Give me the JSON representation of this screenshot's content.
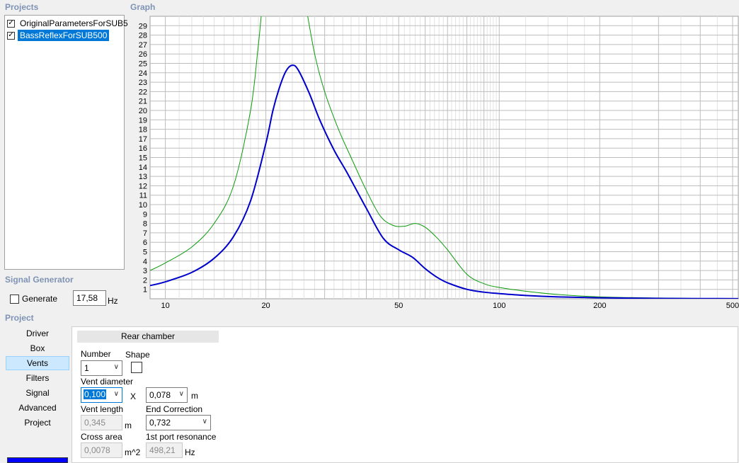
{
  "sections": {
    "projects": "Projects",
    "graph": "Graph",
    "signal_generator": "Signal Generator",
    "project": "Project"
  },
  "projects": [
    {
      "label": "OriginalParametersForSUB5",
      "checked": true,
      "selected": false
    },
    {
      "label": "BassReflexForSUB500",
      "checked": true,
      "selected": true
    }
  ],
  "signal": {
    "generate_label": "Generate",
    "frequency": "17,58",
    "unit": "Hz"
  },
  "nav": [
    "Driver",
    "Box",
    "Vents",
    "Filters",
    "Signal",
    "Advanced",
    "Project"
  ],
  "nav_active": 2,
  "rear": {
    "header": "Rear chamber",
    "number_label": "Number",
    "number_value": "1",
    "shape_label": "Shape",
    "vent_diameter_label": "Vent diameter",
    "vent_diameter_value": "0,100",
    "x_label": "X",
    "vent_diameter2_value": "0,078",
    "m_unit": "m",
    "vent_length_label": "Vent length",
    "vent_length_value": "0,345",
    "end_correction_label": "End Correction",
    "end_correction_value": "0,732",
    "cross_area_label": "Cross area",
    "cross_area_value": "0,0078",
    "cross_area_unit": "m^2",
    "port_resonance_label": "1st port resonance",
    "port_resonance_value": "498,21",
    "hz_unit": "Hz"
  },
  "chart_data": {
    "type": "line",
    "x_scale": "log",
    "xlim": [
      9,
      520
    ],
    "ylim": [
      0,
      30
    ],
    "x_ticks": [
      10,
      20,
      50,
      100,
      200,
      500
    ],
    "y_ticks": [
      1,
      2,
      3,
      4,
      5,
      6,
      7,
      8,
      9,
      10,
      11,
      12,
      13,
      14,
      15,
      16,
      17,
      18,
      19,
      20,
      21,
      22,
      23,
      24,
      25,
      26,
      27,
      28,
      29
    ],
    "grid": true,
    "series": [
      {
        "color": "#0b9b0b",
        "x": [
          9,
          10,
          12,
          14,
          16,
          18,
          19,
          20,
          22,
          24,
          26,
          28,
          30,
          33,
          36,
          40,
          44,
          48,
          52,
          56,
          60,
          65,
          70,
          80,
          90,
          100,
          120,
          150,
          200,
          300,
          400,
          520
        ],
        "y": [
          3.0,
          3.8,
          5.5,
          8.0,
          12.0,
          20.0,
          27.0,
          34.0,
          38.0,
          36.0,
          32.0,
          26.0,
          22.0,
          18.0,
          15.0,
          11.5,
          8.8,
          7.8,
          7.7,
          8.0,
          7.6,
          6.5,
          5.2,
          2.6,
          1.6,
          1.2,
          0.8,
          0.45,
          0.2,
          0.08,
          0.04,
          0.02
        ]
      },
      {
        "color": "#0000cc",
        "x": [
          9,
          10,
          12,
          14,
          16,
          18,
          20,
          21,
          22,
          23,
          24,
          25,
          27,
          29,
          32,
          35,
          40,
          45,
          50,
          55,
          60,
          65,
          70,
          80,
          90,
          100,
          120,
          150,
          200,
          300,
          400,
          520
        ],
        "y": [
          1.4,
          1.8,
          2.8,
          4.3,
          6.6,
          10.4,
          16.5,
          20.0,
          22.5,
          24.2,
          24.8,
          24.3,
          21.8,
          19.0,
          15.8,
          13.4,
          9.6,
          6.4,
          5.2,
          4.4,
          3.2,
          2.3,
          1.7,
          1.0,
          0.7,
          0.55,
          0.35,
          0.2,
          0.1,
          0.04,
          0.02,
          0.01
        ]
      }
    ]
  }
}
